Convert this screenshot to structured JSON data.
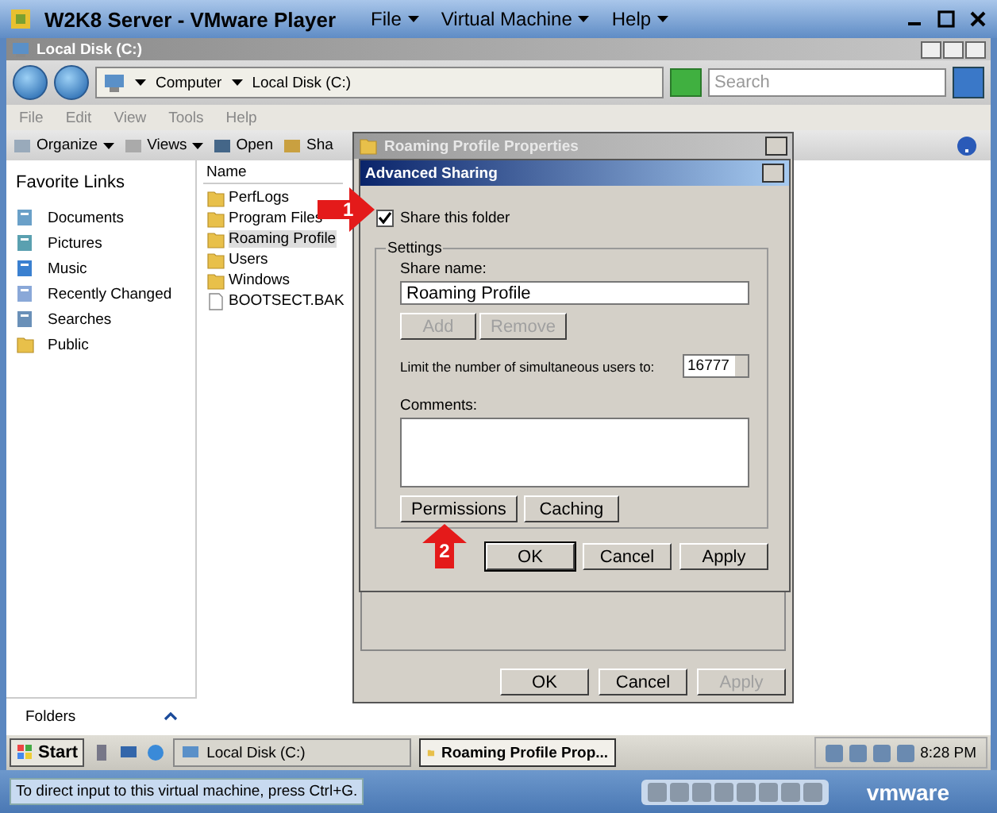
{
  "vmware": {
    "title": "W2K8 Server - VMware Player",
    "menus": [
      "File",
      "Virtual Machine",
      "Help"
    ],
    "status_text": "To direct input to this virtual machine, press Ctrl+G.",
    "logo": "vmware"
  },
  "explorer": {
    "title": "Local Disk (C:)",
    "breadcrumb": [
      "Computer",
      "Local Disk (C:)"
    ],
    "search": {
      "placeholder": "Search"
    },
    "menu": [
      "File",
      "Edit",
      "View",
      "Tools",
      "Help"
    ],
    "toolbar": [
      "Organize",
      "Views",
      "Open",
      "Sha"
    ],
    "favorites_header": "Favorite Links",
    "favorites": [
      "Documents",
      "Pictures",
      "Music",
      "Recently Changed",
      "Searches",
      "Public"
    ],
    "column": "Name",
    "files": [
      {
        "name": "PerfLogs",
        "kind": "folder",
        "selected": false
      },
      {
        "name": "Program Files",
        "kind": "folder",
        "selected": false
      },
      {
        "name": "Roaming Profile",
        "kind": "folder",
        "selected": true
      },
      {
        "name": "Users",
        "kind": "folder",
        "selected": false
      },
      {
        "name": "Windows",
        "kind": "folder",
        "selected": false
      },
      {
        "name": "BOOTSECT.BAK",
        "kind": "file",
        "selected": false
      }
    ],
    "folders_label": "Folders"
  },
  "properties": {
    "title": "Roaming Profile Properties",
    "buttons": [
      {
        "label": "OK",
        "disabled": false
      },
      {
        "label": "Cancel",
        "disabled": false
      },
      {
        "label": "Apply",
        "disabled": true
      }
    ]
  },
  "advanced": {
    "title": "Advanced Sharing",
    "share_checkbox": {
      "label": "Share this folder",
      "checked": true
    },
    "group_label": "Settings",
    "share_name_label": "Share name:",
    "share_name": "Roaming Profile",
    "name_buttons": [
      {
        "label": "Add",
        "disabled": true
      },
      {
        "label": "Remove",
        "disabled": true
      }
    ],
    "limit_label": "Limit the number of simultaneous users to:",
    "limit_value": "16777",
    "comments_label": "Comments:",
    "option_buttons": [
      "Permissions",
      "Caching"
    ],
    "buttons": [
      {
        "label": "OK",
        "disabled": false
      },
      {
        "label": "Cancel",
        "disabled": false
      },
      {
        "label": "Apply",
        "disabled": false
      }
    ]
  },
  "annotations": [
    {
      "number": "1",
      "kind": "right"
    },
    {
      "number": "2",
      "kind": "up"
    }
  ],
  "taskbar": {
    "start": "Start",
    "tasks": [
      {
        "label": "Local Disk (C:)",
        "selected": false
      },
      {
        "label": "Roaming Profile Prop...",
        "selected": true
      }
    ],
    "clock": "8:28 PM"
  }
}
